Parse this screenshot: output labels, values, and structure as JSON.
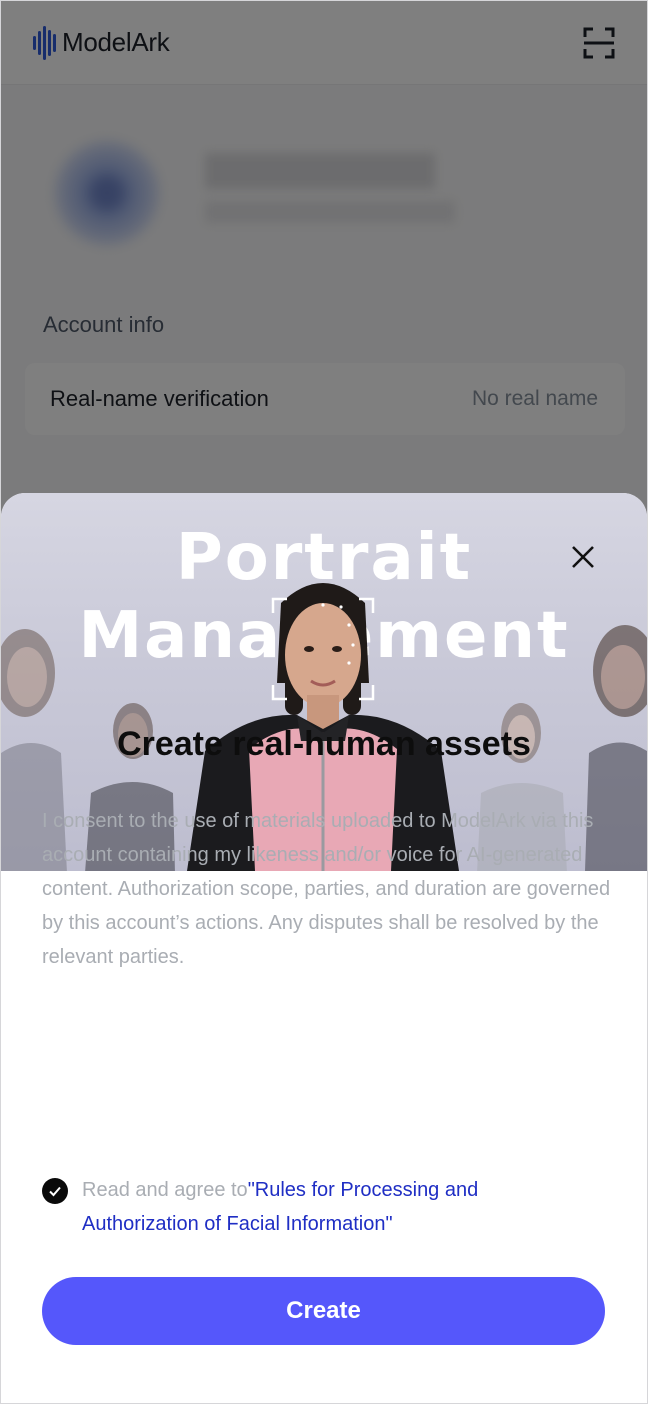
{
  "header": {
    "brand": "ModelArk",
    "scan_icon": "scan-icon"
  },
  "account": {
    "section_title": "Account info",
    "rows": [
      {
        "label": "Real-name verification",
        "value": "No real name"
      }
    ]
  },
  "modal": {
    "hero_title_line1": "Portrait",
    "hero_title_line2": "Management",
    "close_icon": "close-icon",
    "title": "Create real-human assets",
    "consent_text": "I consent to the use of materials uploaded to ModelArk via this account containing my likeness and/or voice for AI-generated content. Authorization scope, parties, and duration are governed by this account’s actions. Any disputes shall be resolved by the relevant parties.",
    "agree_prefix": "Read and agree to",
    "agree_link": "\"Rules for Processing and Authorization of Facial Information\"",
    "agree_checked": true,
    "create_label": "Create"
  },
  "colors": {
    "primary": "#5557fb",
    "link": "#1f2ec4",
    "brand_blue": "#2e5bd8"
  }
}
